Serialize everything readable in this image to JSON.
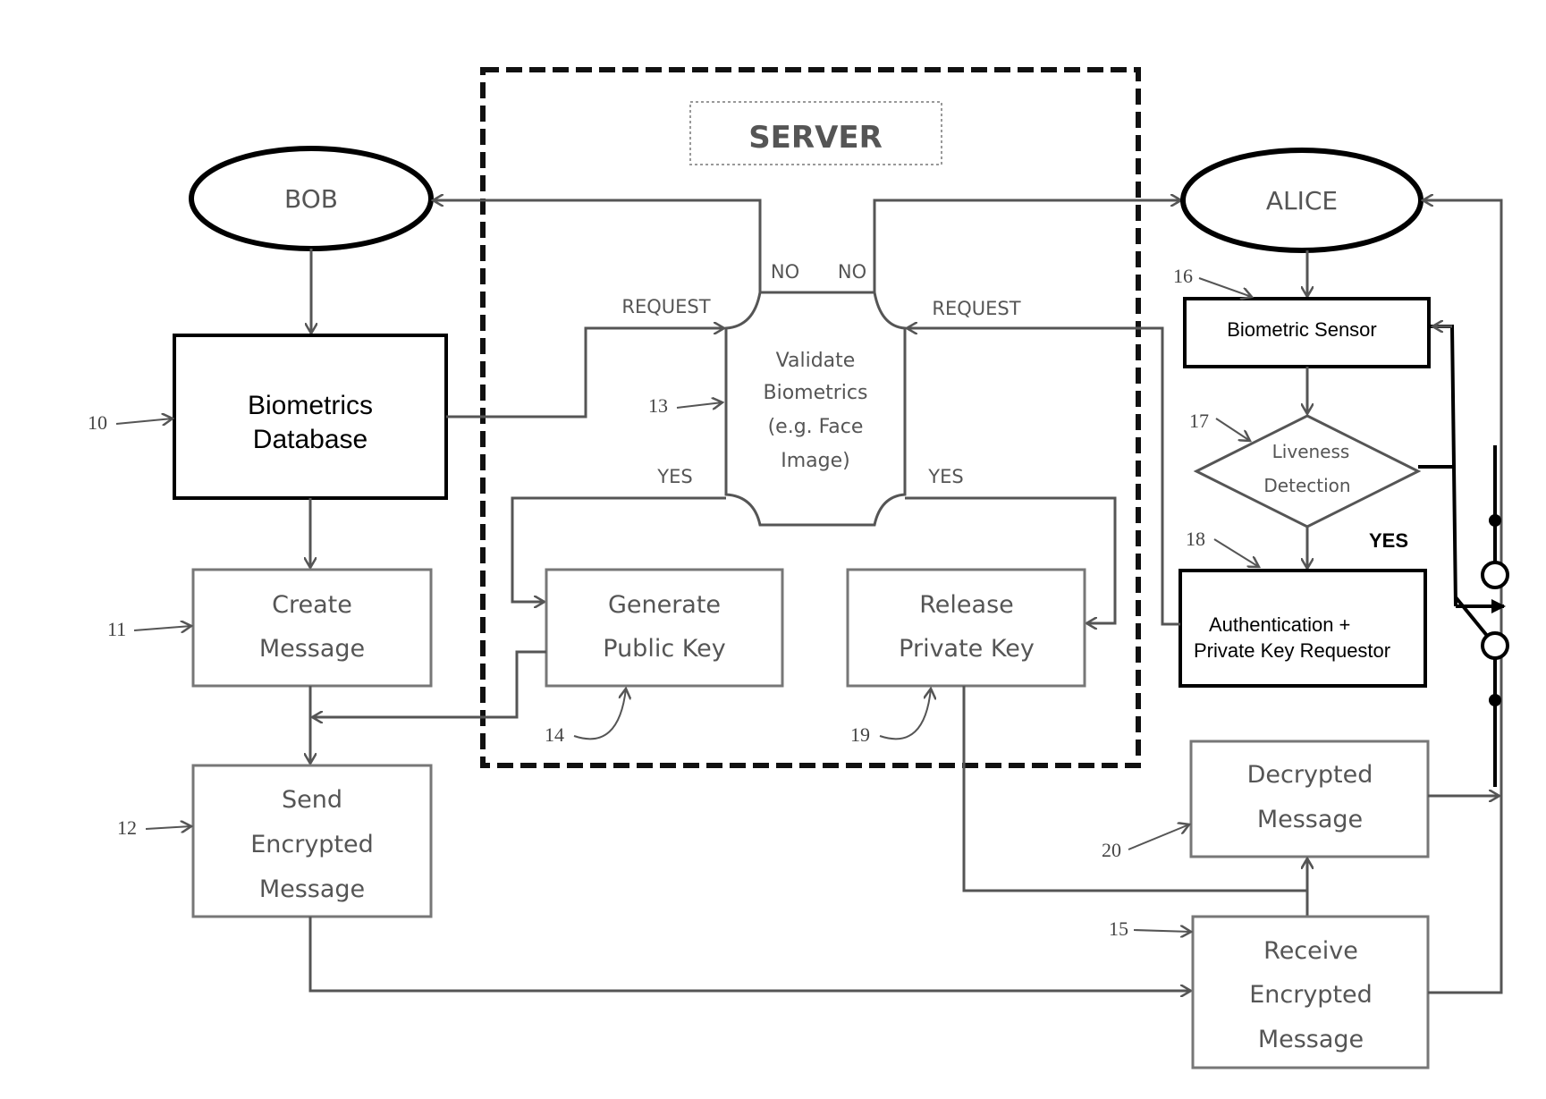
{
  "title": "SERVER",
  "actors": {
    "bob": "BOB",
    "alice": "ALICE"
  },
  "bob_side": {
    "biometrics_database": [
      "Biometrics",
      "Database"
    ],
    "create_message": [
      "Create",
      "Message"
    ],
    "send_encrypted_message": [
      "Send",
      "Encrypted",
      "Message"
    ]
  },
  "server": {
    "validate_biometrics": [
      "Validate",
      "Biometrics",
      "(e.g. Face",
      "Image)"
    ],
    "generate_public_key": [
      "Generate",
      "Public Key"
    ],
    "release_private_key": [
      "Release",
      "Private Key"
    ],
    "labels": {
      "request_left": "REQUEST",
      "request_right": "REQUEST",
      "no_left": "NO",
      "no_right": "NO",
      "yes_left": "YES",
      "yes_right": "YES"
    }
  },
  "alice_side": {
    "biometric_sensor": "Biometric Sensor",
    "liveness_detection": [
      "Liveness",
      "Detection"
    ],
    "liveness_yes": "YES",
    "auth_requestor": [
      "Authentication +",
      "Private Key Requestor"
    ],
    "decrypted_message": [
      "Decrypted",
      "Message"
    ],
    "receive_encrypted_message": [
      "Receive",
      "Encrypted",
      "Message"
    ]
  },
  "reference_numerals": {
    "n10": "10",
    "n11": "11",
    "n12": "12",
    "n13": "13",
    "n14": "14",
    "n15": "15",
    "n16": "16",
    "n17": "17",
    "n18": "18",
    "n19": "19",
    "n20": "20"
  }
}
